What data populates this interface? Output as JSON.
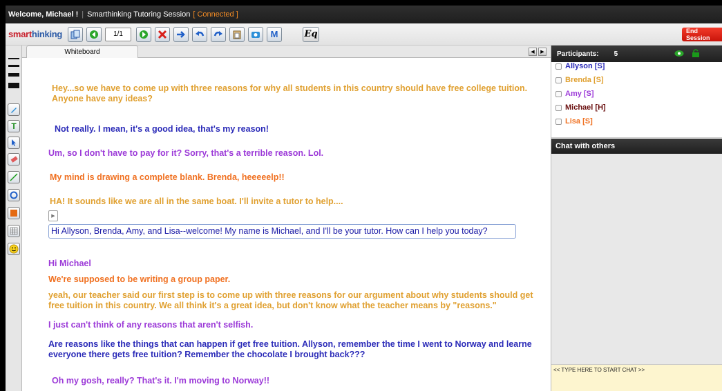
{
  "titlebar": {
    "welcome": "Welcome, Michael !",
    "session": "Smarthinking Tutoring Session",
    "status": "[ Connected ]"
  },
  "toolbar": {
    "logo_part1": "smart",
    "logo_part2": "hinking",
    "page_indicator": "1/1",
    "icons": [
      "copy-icon",
      "back-icon",
      "forward-icon",
      "delete-icon",
      "arrow-right-icon",
      "undo-icon",
      "redo-icon",
      "paste-icon",
      "camera-icon",
      "m-icon"
    ],
    "m_label": "M",
    "eq_label": "Eq",
    "end_session_label": "End Session"
  },
  "whiteboard": {
    "tab_label": "Whiteboard",
    "messages": [
      {
        "text": "Hey...so we have to come up with three reasons for why all students in this country should have free college tuition.",
        "color": "#e0a030"
      },
      {
        "text": "Anyone have any ideas?",
        "color": "#e0a030"
      },
      {
        "text": "Not really.  I mean, it's a good idea, that's my reason!",
        "color": "#2b2bb8"
      },
      {
        "text": "Um, so I don't have to pay for it? Sorry, that's a terrible reason. Lol.",
        "color": "#9c3ad8"
      },
      {
        "text": "My mind is drawing a complete blank. Brenda, heeeeelp!!",
        "color": "#f07020"
      },
      {
        "text": "HA! It sounds like we are all in the same boat.  I'll invite a tutor to help....",
        "color": "#e0a030"
      },
      {
        "text": "Hi Michael",
        "color": "#9c3ad8"
      },
      {
        "text": "We're supposed to be writing a group paper.",
        "color": "#f07020"
      },
      {
        "text": "yeah, our teacher said our first step is to come up with three reasons for our argument about why students should get",
        "color": "#e0a030"
      },
      {
        "text": "free tuition in this country.  We all think it's a great idea, but don't know what the teacher means by \"reasons.\"",
        "color": "#e0a030"
      },
      {
        "text": "I just can't think of any reasons that aren't selfish.",
        "color": "#9c3ad8"
      },
      {
        "text": "Are reasons like the things that can happen if get free tuition.  Allyson, remember the time I went to Norway and learne",
        "color": "#2b2bb8"
      },
      {
        "text": "everyone there gets free tuition?  Remember the chocolate I brought back???",
        "color": "#2b2bb8"
      },
      {
        "text": "Oh my gosh, really? That's it. I'm moving to Norway!!",
        "color": "#9c3ad8"
      }
    ],
    "tutor_input": "Hi Allyson, Brenda, Amy, and Lisa--welcome!  My name is Michael, and I'll be your tutor.  How can I help you today?"
  },
  "participants": {
    "label": "Participants:",
    "count": "5",
    "list": [
      {
        "name": "Allyson [S]",
        "color": "#2b2bb8"
      },
      {
        "name": "Brenda [S]",
        "color": "#e0a030"
      },
      {
        "name": "Amy [S]",
        "color": "#9c3ad8"
      },
      {
        "name": "Michael [H]",
        "color": "#6a0f0f"
      },
      {
        "name": "Lisa [S]",
        "color": "#f07020"
      }
    ]
  },
  "chat": {
    "title": "Chat with others",
    "input_placeholder": "<< TYPE HERE TO START CHAT >>"
  },
  "colors": {
    "accent_red": "#d8201a",
    "chat_input_bg": "#fdf5cf",
    "panel_header": "#2a2a2a"
  }
}
